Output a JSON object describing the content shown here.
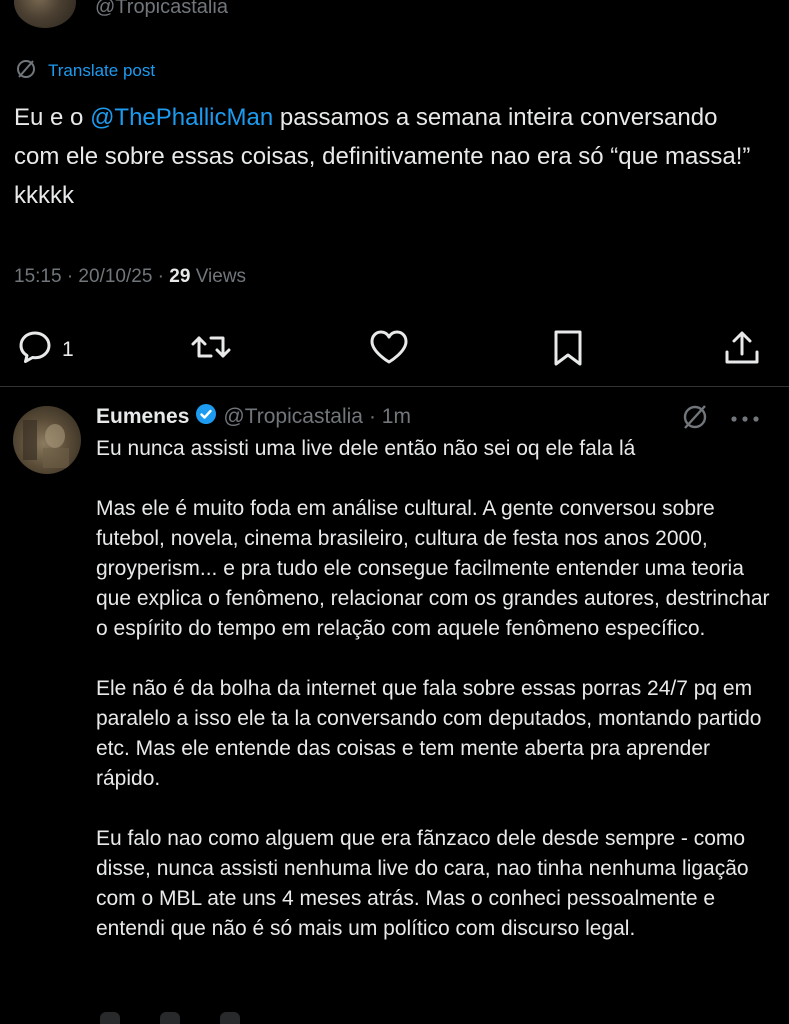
{
  "post": {
    "handle": "@Tropicastalia",
    "translate_label": "Translate post",
    "text_before_mention": "Eu e o ",
    "mention": "@ThePhallicMan",
    "text_after_mention": " passamos a semana inteira conversando com ele sobre essas coisas, definitivamente nao era só “que massa!” kkkkk",
    "meta_time": "15:15 · 20/10/25 · ",
    "meta_views_count": "29",
    "meta_views_label": " Views"
  },
  "actions": {
    "reply_count": "1",
    "icons": [
      "reply-icon",
      "retweet-icon",
      "like-icon",
      "bookmark-icon",
      "share-icon"
    ]
  },
  "reply": {
    "name": "Eumenes",
    "handle": "@Tropicastalia",
    "time": "· 1m",
    "paragraphs": [
      "Eu nunca assisti uma live dele então não sei oq ele fala lá",
      "Mas ele é muito foda em análise cultural. A gente conversou sobre futebol, novela, cinema brasileiro, cultura de festa nos anos 2000, groyperism... e pra tudo ele consegue facilmente entender uma teoria que explica o fenômeno, relacionar com os grandes autores, destrinchar o espírito do tempo em relação com aquele fenômeno específico.",
      "Ele não é da bolha da internet que fala sobre essas porras 24/7 pq em paralelo a isso ele ta la conversando com deputados, montando partido etc. Mas ele entende das coisas e tem mente aberta pra aprender rápido.",
      "Eu falo nao como alguem que era fãnzaco dele desde sempre - como disse, nunca assisti nenhuma live do cara, nao tinha nenhuma ligação com o MBL ate uns 4 meses atrás. Mas o conheci pessoalmente e entendi que não é só mais um político com discurso legal."
    ]
  },
  "colors": {
    "background": "#000000",
    "text": "#e7e9ea",
    "muted": "#71767b",
    "accent": "#1d9bf0",
    "verified": "#1d9bf0"
  }
}
